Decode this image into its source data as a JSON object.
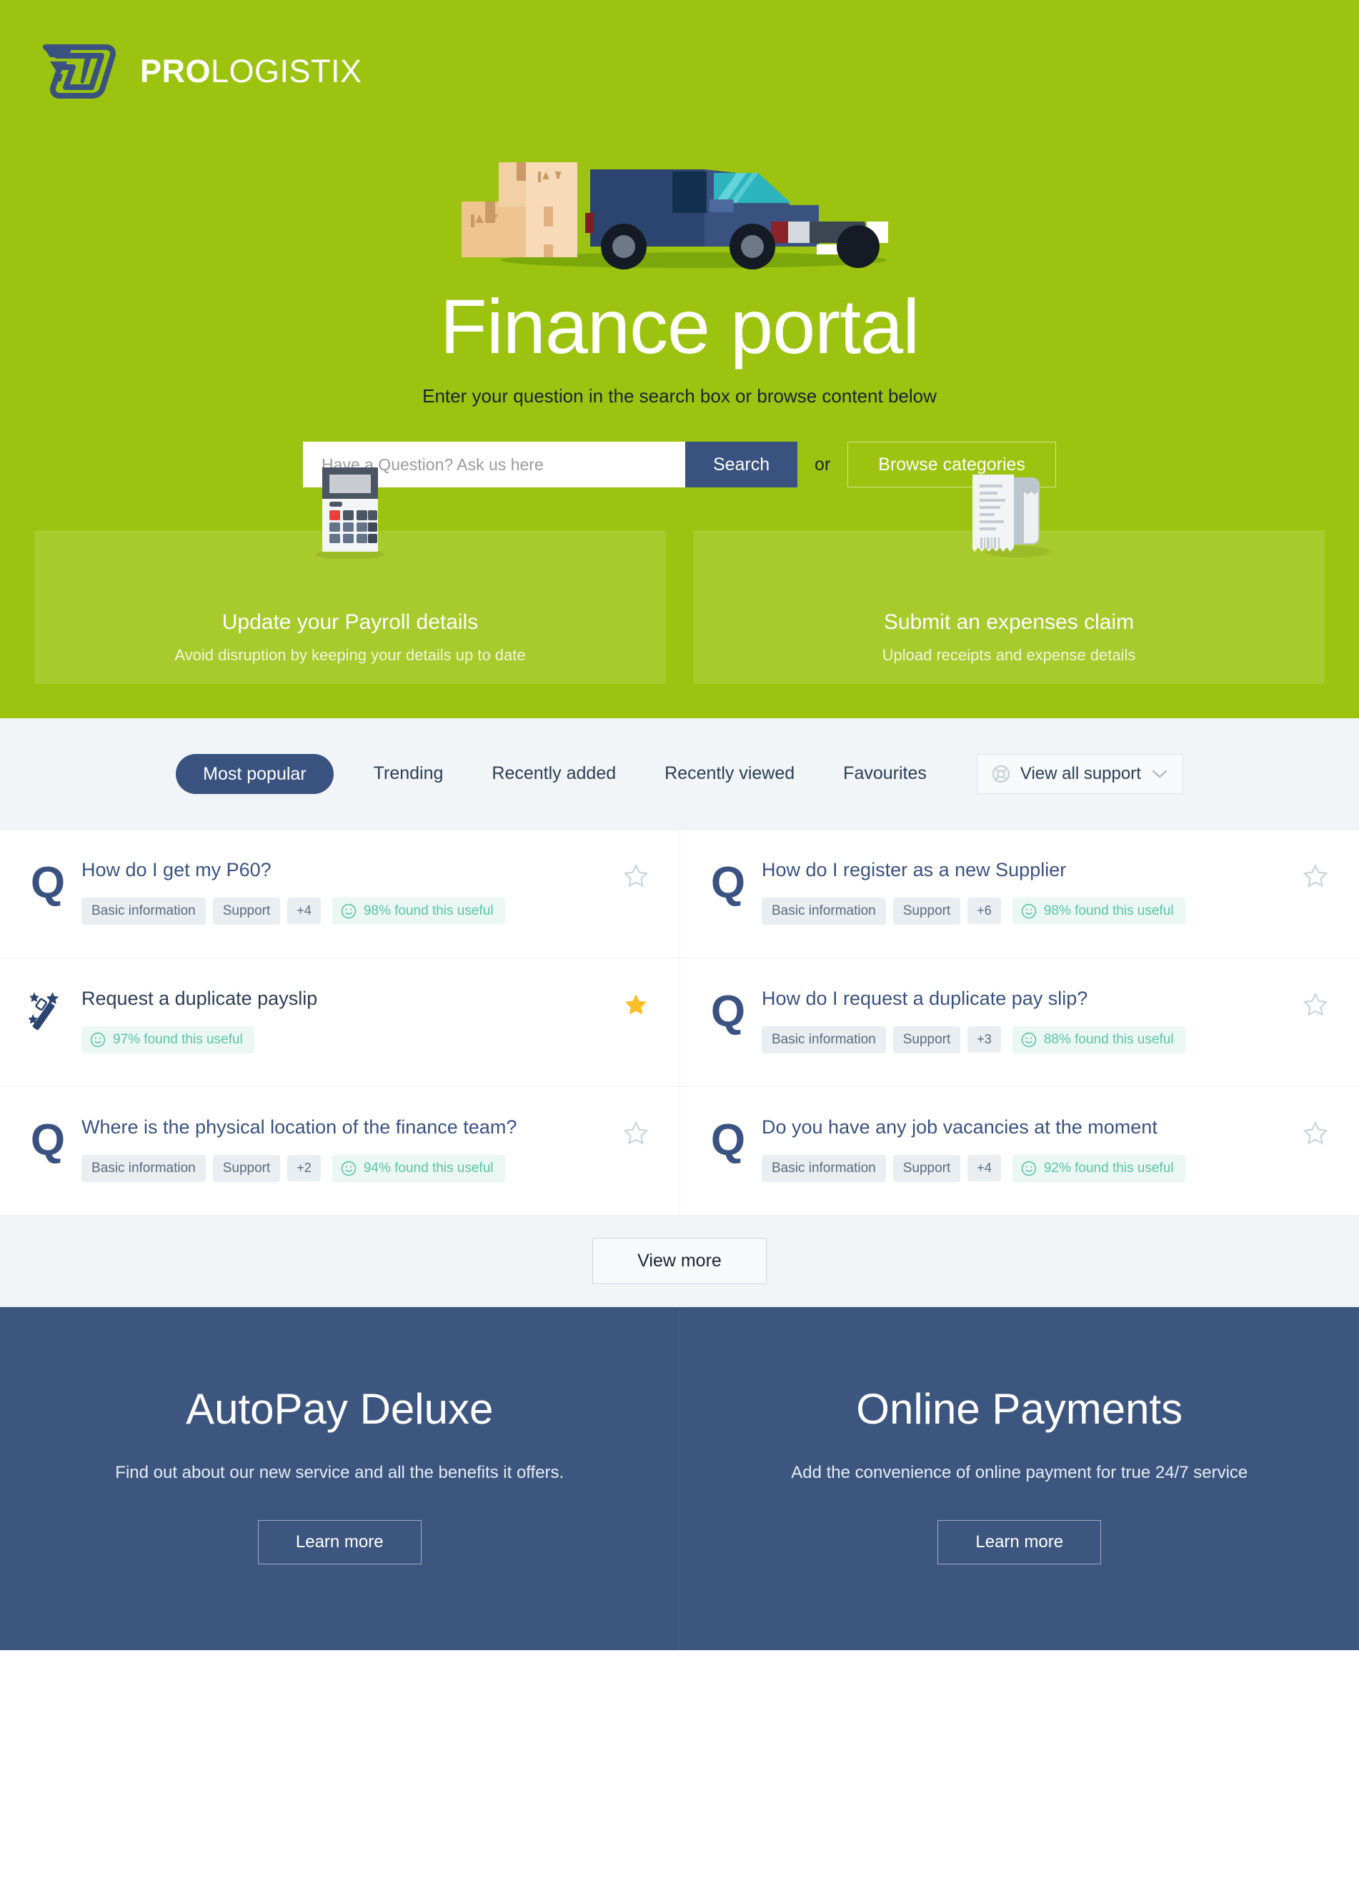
{
  "brand": {
    "name_bold": "PRO",
    "name_light": "LOGISTIX",
    "logo_color": "#3A5280",
    "hero_green": "#9BC30F",
    "accent_navy": "#3A5280"
  },
  "hero": {
    "title": "Finance portal",
    "subtitle": "Enter your question in the search box or browse content below",
    "search": {
      "placeholder": "Have a Question? Ask us here",
      "value": "",
      "button_label": "Search",
      "or_label": "or",
      "browse_label": "Browse categories"
    },
    "promos": [
      {
        "icon": "calculator-icon",
        "title": "Update your Payroll details",
        "desc": "Avoid disruption by keeping your details up to date"
      },
      {
        "icon": "receipt-icon",
        "title": "Submit an expenses claim",
        "desc": "Upload receipts and expense details"
      }
    ]
  },
  "tabs": {
    "items": [
      {
        "label": "Most popular",
        "active": true
      },
      {
        "label": "Trending",
        "active": false
      },
      {
        "label": "Recently added",
        "active": false
      },
      {
        "label": "Recently viewed",
        "active": false
      },
      {
        "label": "Favourites",
        "active": false
      }
    ],
    "view_all": {
      "label": "View all support",
      "icon": "life-ring-icon",
      "chevron": "chevron-down-icon"
    }
  },
  "list": {
    "left": [
      {
        "icon": "question-icon",
        "title": "How do I get my P60?",
        "chips": [
          "Basic information",
          "Support"
        ],
        "more": "+4",
        "useful": "98% found this useful",
        "favourited": false
      },
      {
        "icon": "magic-wand-icon",
        "title": "Request a duplicate payslip",
        "chips": [],
        "more": "",
        "useful": "97% found this useful",
        "favourited": true
      },
      {
        "icon": "question-icon",
        "title": "Where is the physical location of the finance team?",
        "chips": [
          "Basic information",
          "Support"
        ],
        "more": "+2",
        "useful": "94% found this useful",
        "favourited": false
      }
    ],
    "right": [
      {
        "icon": "question-icon",
        "title": "How do I register as a new Supplier",
        "chips": [
          "Basic information",
          "Support"
        ],
        "more": "+6",
        "useful": "98% found this useful",
        "favourited": false
      },
      {
        "icon": "question-icon",
        "title": "How do I request a duplicate pay slip?",
        "chips": [
          "Basic information",
          "Support"
        ],
        "more": "+3",
        "useful": "88% found this useful",
        "favourited": false
      },
      {
        "icon": "question-icon",
        "title": "Do you have any job vacancies at the moment",
        "chips": [
          "Basic information",
          "Support"
        ],
        "more": "+4",
        "useful": "92% found this useful",
        "favourited": false
      }
    ],
    "view_more_label": "View more"
  },
  "banners": [
    {
      "title": "AutoPay Deluxe",
      "desc": "Find out about our new service and all the benefits it offers.",
      "button": "Learn more"
    },
    {
      "title": "Online Payments",
      "desc": "Add the convenience of online payment for true 24/7 service",
      "button": "Learn more"
    }
  ]
}
